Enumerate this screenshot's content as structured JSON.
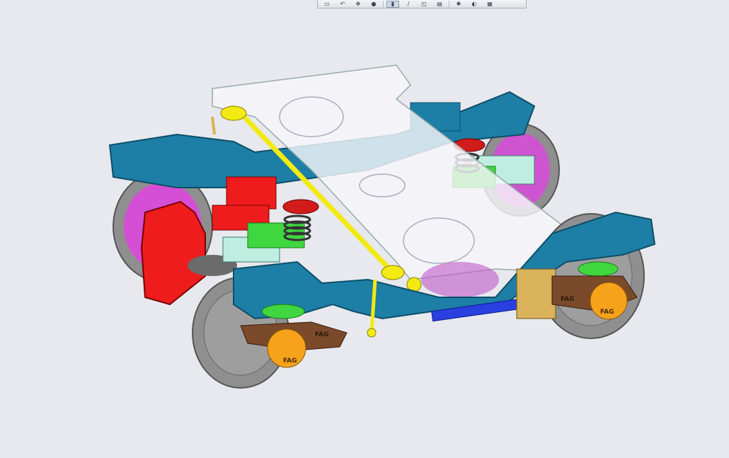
{
  "toolbar": {
    "buttons": [
      {
        "icon": "zoom-window-icon",
        "glyph": "▭"
      },
      {
        "icon": "rotate-icon",
        "glyph": "↶"
      },
      {
        "icon": "pan-icon",
        "glyph": "✥"
      },
      {
        "icon": "sphere-display-icon",
        "glyph": "●"
      },
      {
        "icon": "cursor-select-icon",
        "glyph": "▮"
      },
      {
        "icon": "sketch-line-icon",
        "glyph": "/"
      },
      {
        "icon": "view-orientation-icon",
        "glyph": "◰"
      },
      {
        "icon": "section-view-icon",
        "glyph": "▤"
      },
      {
        "icon": "hide-show-icon",
        "glyph": "✱"
      },
      {
        "icon": "render-mode-icon",
        "glyph": "◐"
      },
      {
        "icon": "appearance-icon",
        "glyph": "▦"
      }
    ]
  },
  "model": {
    "labels": {
      "bearing_left": "FAG",
      "bearing_front": "FAG",
      "bearing_right": "FAG",
      "bearing_right2": "FAG"
    },
    "colors": {
      "frame": "#1d7fa6",
      "frame_dark": "#0f5d7d",
      "wheel": "#9a9a9a",
      "wheel_disc": "#d54fd6",
      "motor": "#ee1c1c",
      "transparent_bolster": "#f4f4f8",
      "axlebox": "#f7a21b",
      "axlebox_arm": "#7a4a2a",
      "rubber": "#4fd04f",
      "spring": "#444444",
      "yellow": "#f2ea12",
      "mint": "#bfeee0",
      "damper_blue": "#2a3fe0",
      "bracket_red": "#d21c1c",
      "bracket_brown": "#d9b25a"
    }
  }
}
